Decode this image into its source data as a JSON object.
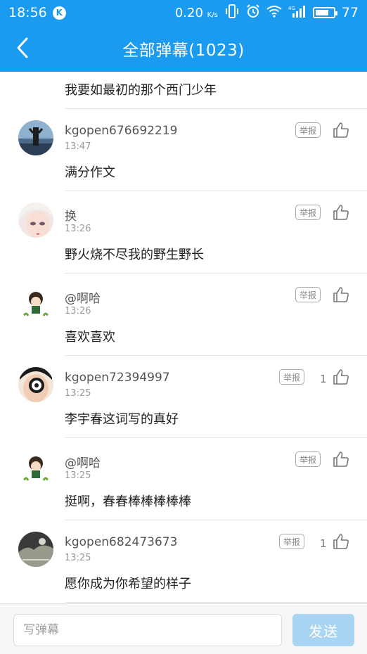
{
  "status_bar": {
    "time": "18:56",
    "app_badge": "K",
    "speed": "0.20",
    "speed_unit": "K/s",
    "battery": "77",
    "battery_level": 0.77
  },
  "header": {
    "title": "全部弹幕(1023)",
    "background_color": "#1a9bf0"
  },
  "comments": [
    {
      "content": "我要如最初的那个西门少年"
    },
    {
      "user": "kgopen676692219",
      "time": "13:47",
      "content": "满分作文",
      "report_label": "举报",
      "likes": ""
    },
    {
      "user": "换",
      "time": "13:26",
      "content": "野火烧不尽我的野生野长",
      "report_label": "举报",
      "likes": ""
    },
    {
      "user": "@啊哈",
      "time": "13:26",
      "content": "喜欢喜欢",
      "report_label": "举报",
      "likes": ""
    },
    {
      "user": "kgopen72394997",
      "time": "13:25",
      "content": "李宇春这词写的真好",
      "report_label": "举报",
      "likes": "1"
    },
    {
      "user": "@啊哈",
      "time": "13:25",
      "content": "挺啊，春春棒棒棒棒棒",
      "report_label": "举报",
      "likes": ""
    },
    {
      "user": "kgopen682473673",
      "time": "13:25",
      "content": "愿你成为你希望的样子",
      "report_label": "举报",
      "likes": "1"
    }
  ],
  "composer": {
    "placeholder": "写弹幕",
    "value": "",
    "send_label": "发送",
    "send_color": "#a9d5f3"
  }
}
